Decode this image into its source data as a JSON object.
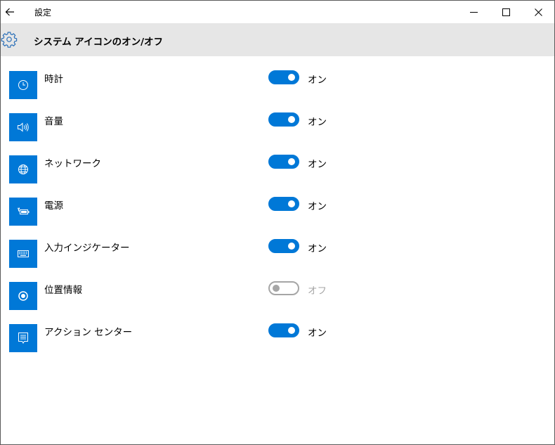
{
  "window": {
    "title": "設定"
  },
  "header": {
    "page_title": "システム アイコンのオン/オフ"
  },
  "items": [
    {
      "label": "時計",
      "icon": "clock-icon",
      "state": "on",
      "state_label": "オン"
    },
    {
      "label": "音量",
      "icon": "speaker-icon",
      "state": "on",
      "state_label": "オン"
    },
    {
      "label": "ネットワーク",
      "icon": "globe-icon",
      "state": "on",
      "state_label": "オン"
    },
    {
      "label": "電源",
      "icon": "battery-plug-icon",
      "state": "on",
      "state_label": "オン"
    },
    {
      "label": "入力インジケーター",
      "icon": "keyboard-icon",
      "state": "on",
      "state_label": "オン"
    },
    {
      "label": "位置情報",
      "icon": "location-icon",
      "state": "off",
      "state_label": "オフ"
    },
    {
      "label": "アクション センター",
      "icon": "action-center-icon",
      "state": "on",
      "state_label": "オン"
    }
  ],
  "colors": {
    "accent": "#0078d7",
    "header_bg": "#e6e6e6",
    "off_gray": "#a6a6a6"
  }
}
